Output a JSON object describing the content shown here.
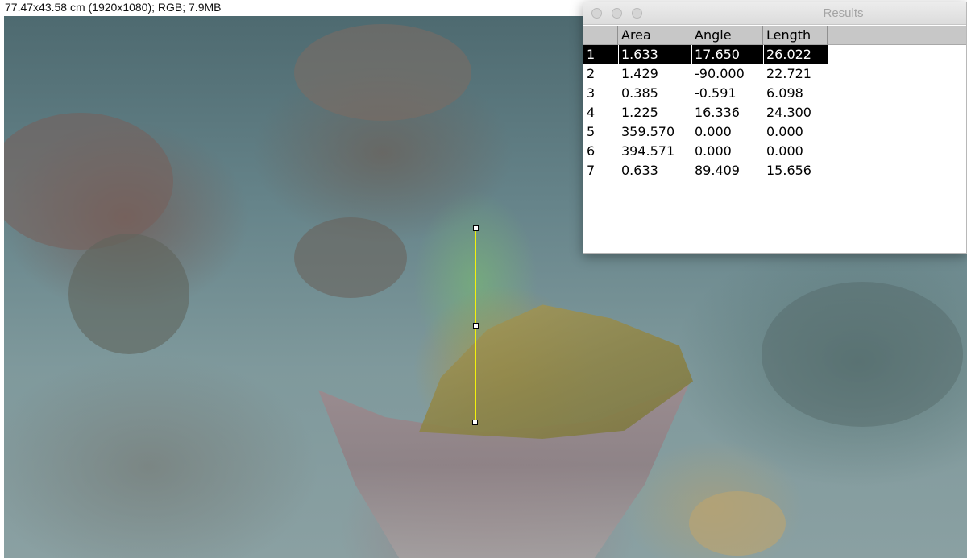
{
  "info_bar": {
    "text": "77.47x43.58 cm (1920x1080); RGB; 7.9MB"
  },
  "measurement_line": {
    "color": "#f2f20c"
  },
  "results_window": {
    "title": "Results",
    "columns": [
      "",
      "Area",
      "Angle",
      "Length"
    ],
    "selected_row": 1,
    "rows": [
      {
        "index": "1",
        "area": "1.633",
        "angle": "17.650",
        "length": "26.022"
      },
      {
        "index": "2",
        "area": "1.429",
        "angle": "-90.000",
        "length": "22.721"
      },
      {
        "index": "3",
        "area": "0.385",
        "angle": "-0.591",
        "length": "6.098"
      },
      {
        "index": "4",
        "area": "1.225",
        "angle": "16.336",
        "length": "24.300"
      },
      {
        "index": "5",
        "area": "359.570",
        "angle": "0.000",
        "length": "0.000"
      },
      {
        "index": "6",
        "area": "394.571",
        "angle": "0.000",
        "length": "0.000"
      },
      {
        "index": "7",
        "area": "0.633",
        "angle": "89.409",
        "length": "15.656"
      }
    ]
  }
}
